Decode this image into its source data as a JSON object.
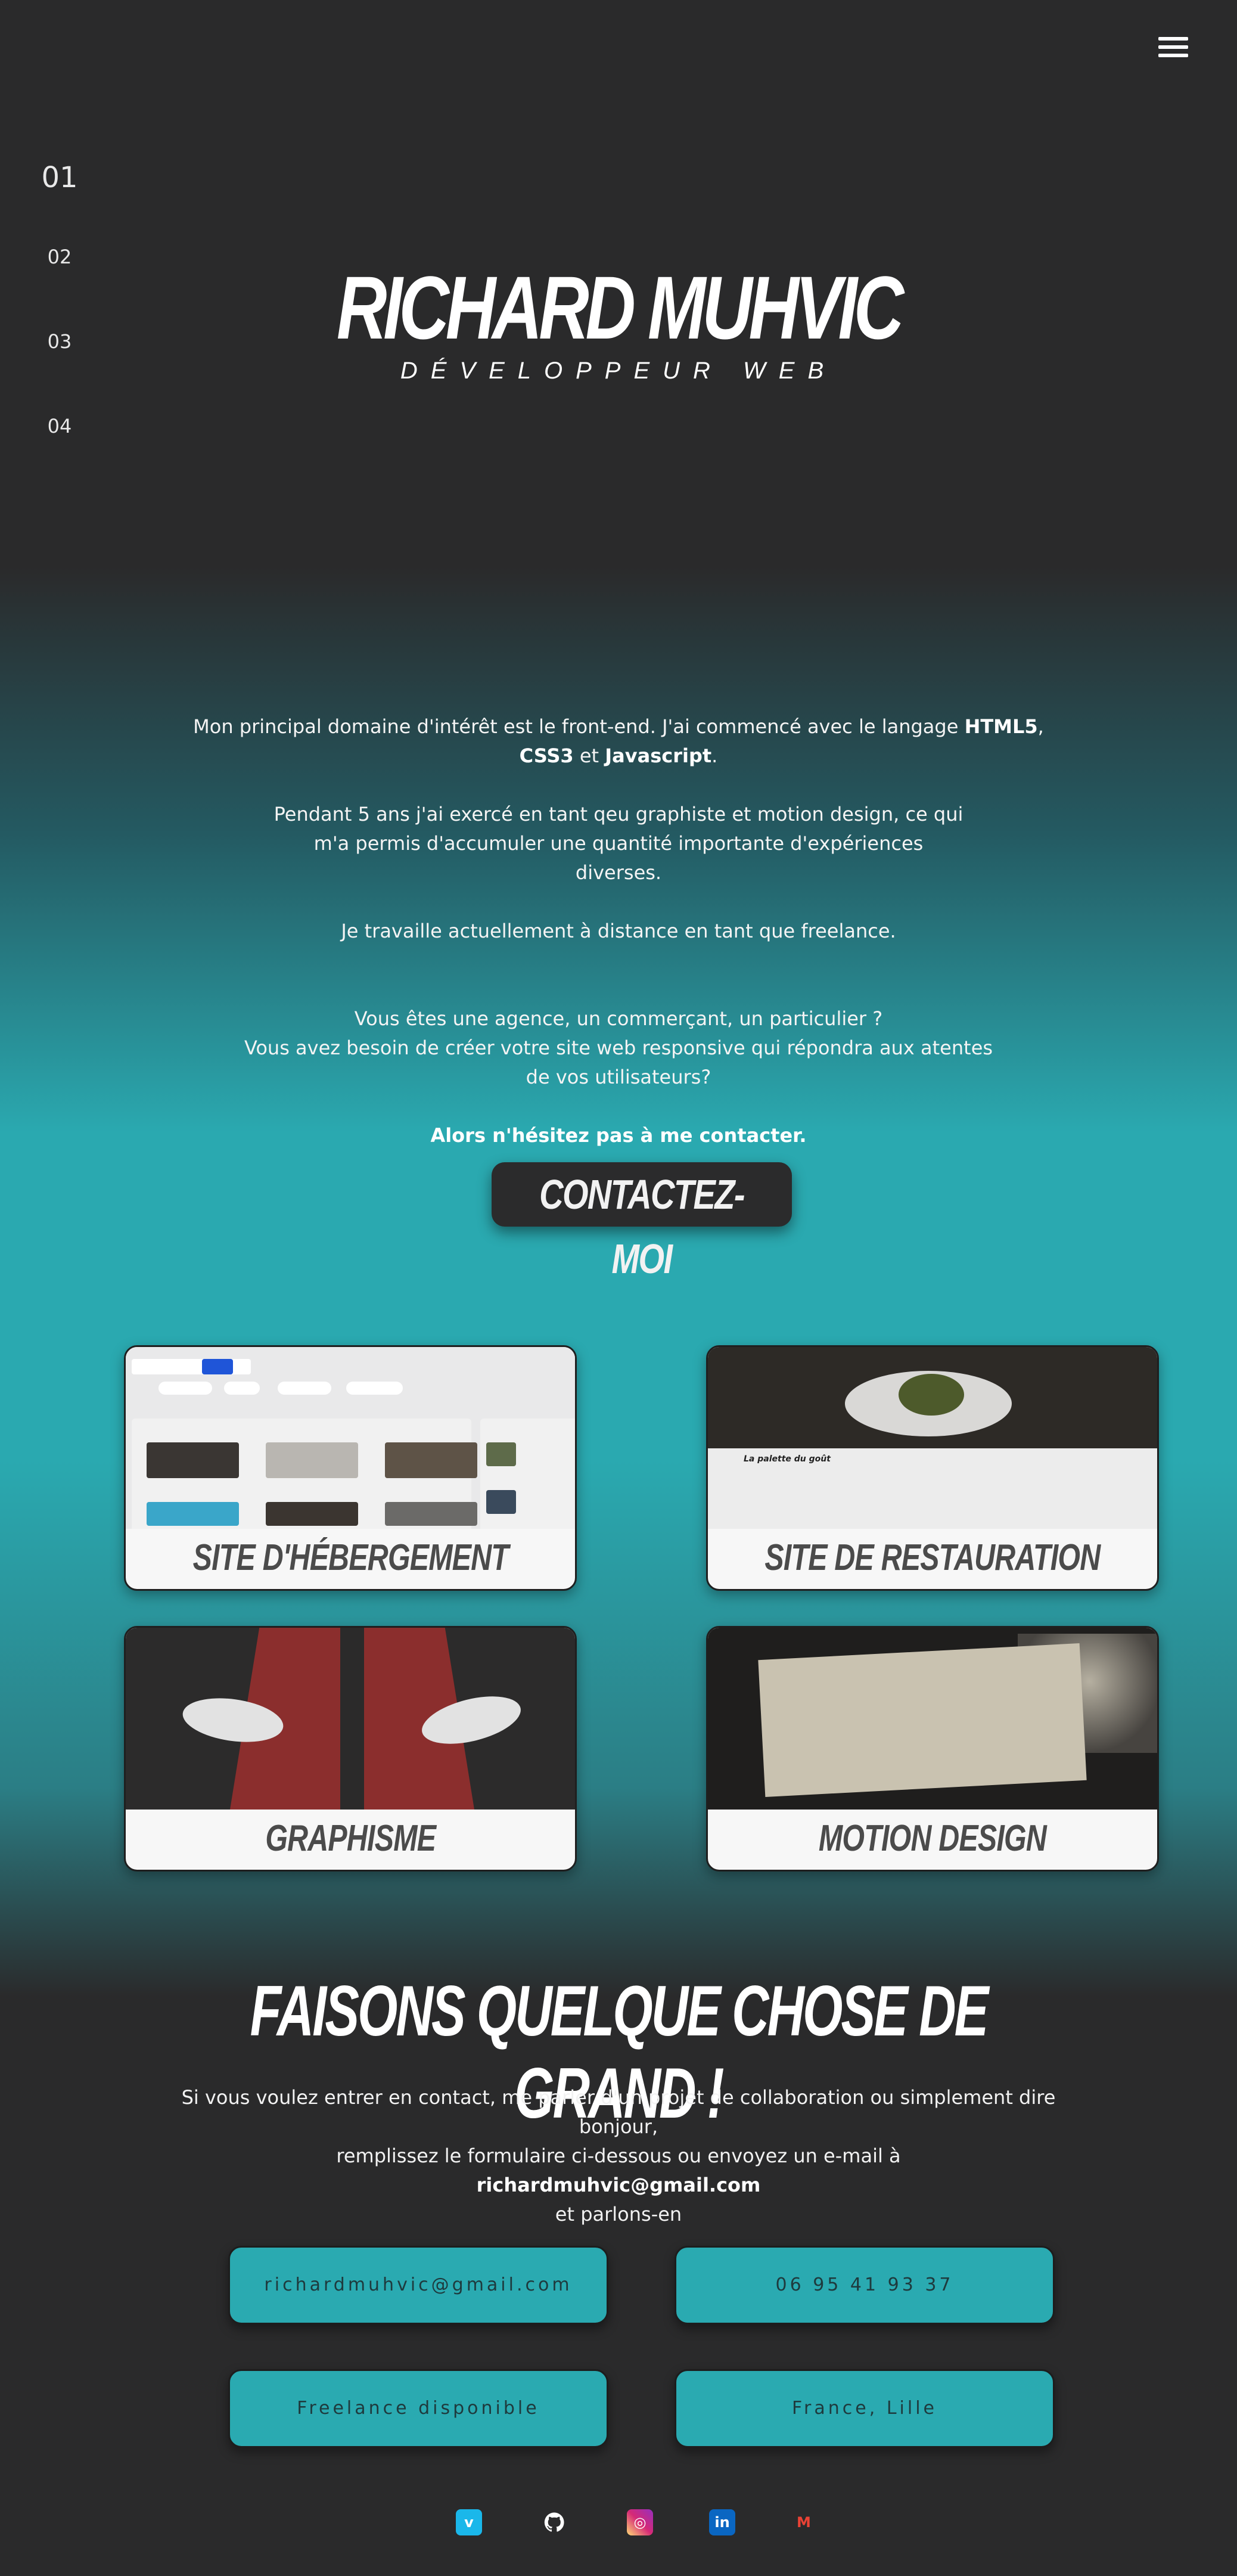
{
  "menu": {
    "icon": "hamburger-menu-icon"
  },
  "side_nav": [
    "01",
    "02",
    "03",
    "04"
  ],
  "hero": {
    "name": "RICHARD MUHVIC",
    "subtitle": "DÉVELOPPEUR WEB"
  },
  "intro": {
    "p1_a": "Mon principal domaine d'intérêt est le front-end. J'ai commencé avec le langage ",
    "p1_html5": "HTML5",
    "p1_b": ",",
    "p1_css3": "CSS3",
    "p1_c": " et ",
    "p1_js": "Javascript",
    "p1_d": ".",
    "p2": "Pendant 5 ans j'ai exercé en tant qeu graphiste et motion design, ce qui m'a permis d'accumuler une quantité importante d'expériences diverses.",
    "p3": "Je travaille actuellement à distance en tant que freelance.",
    "p4_line1": "Vous êtes une agence, un commerçant, un particulier ?",
    "p4_line2": "Vous avez besoin de créer votre site web responsive qui répondra aux atentes de vos utilisateurs?",
    "p5": "Alors n'hésitez pas à me contacter."
  },
  "contact_button": "CONTACTEZ-MOI",
  "projects": [
    {
      "label": "SITE D'HÉBERGEMENT"
    },
    {
      "label": "SITE DE RESTAURATION"
    },
    {
      "label": "GRAPHISME"
    },
    {
      "label": "MOTION DESIGN"
    }
  ],
  "contact": {
    "title": "FAISONS QUELQUE CHOSE DE GRAND !",
    "line1": "Si vous voulez entrer en contact, me parler d'un projet de collaboration ou simplement dire bonjour,",
    "line2": "remplissez le formulaire ci-dessous ou envoyez un e-mail à",
    "email": "richardmuhvic@gmail.com",
    "line3": "et parlons-en"
  },
  "info_boxes": {
    "email": "richardmuhvic@gmail.com",
    "phone": "06 95 41 93 37",
    "status": "Freelance disponible",
    "location": "France, Lille"
  },
  "social": [
    {
      "name": "vimeo-icon",
      "glyph": "v",
      "color": "#1ab7ea"
    },
    {
      "name": "github-icon",
      "glyph": "",
      "color": "#2a2a2a"
    },
    {
      "name": "instagram-icon",
      "glyph": "◎",
      "color": "#d6249f"
    },
    {
      "name": "linkedin-icon",
      "glyph": "in",
      "color": "#0a66c2"
    },
    {
      "name": "gmail-icon",
      "glyph": "M",
      "color": "#2a2a2b"
    }
  ],
  "colors": {
    "background_dark": "#2a2a2b",
    "teal": "#2aa9b0",
    "card_label": "#4b4b4b"
  }
}
